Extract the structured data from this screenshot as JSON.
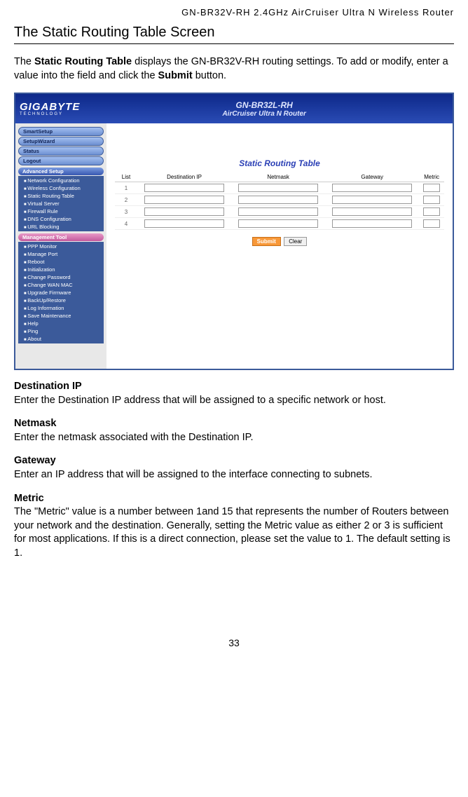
{
  "header": {
    "product": "GN-BR32V-RH 2.4GHz AirCruiser Ultra N Wireless Router"
  },
  "section": {
    "title": "The Static Routing Table Screen",
    "intro_pre": "The ",
    "intro_bold1": "Static Routing Table",
    "intro_mid": " displays the GN-BR32V-RH routing settings. To add or modify, enter a value into the field and click the ",
    "intro_bold2": "Submit",
    "intro_post": " button."
  },
  "screenshot": {
    "logo": {
      "brand": "GIGABYTE",
      "tagline": "TECHNOLOGY"
    },
    "model": {
      "line1": "GN-BR32L-RH",
      "line2": "AirCruiser Ultra N Router"
    },
    "sidebar": {
      "top_buttons": [
        "SmartSetup",
        "SetupWizard",
        "Status",
        "Logout"
      ],
      "advanced_header": "Advanced Setup",
      "advanced_items": [
        "Network Configuration",
        "Wireless Configuration",
        "Static Routing Table",
        "Virtual Server",
        "Firewall Rule",
        "DNS Configuration",
        "URL Blocking"
      ],
      "mgmt_header": "Management Tool",
      "mgmt_items": [
        "PPP Monitor",
        "Manage Port",
        "Reboot",
        "Initialization",
        "Change Password",
        "Change WAN MAC",
        "Upgrade Firmware",
        "BackUp/Restore",
        "Log Information",
        "Save Maintenance",
        "Help",
        "Ping",
        "About"
      ]
    },
    "table": {
      "title": "Static Routing Table",
      "headers": [
        "List",
        "Destination IP",
        "Netmask",
        "Gateway",
        "Metric"
      ],
      "rows": [
        "1",
        "2",
        "3",
        "4"
      ],
      "submit": "Submit",
      "clear": "Clear"
    }
  },
  "definitions": [
    {
      "term": "Destination IP",
      "desc": "Enter the Destination IP address that will be assigned to a specific network or host."
    },
    {
      "term": "Netmask",
      "desc": "Enter the netmask associated with the Destination IP."
    },
    {
      "term": "Gateway",
      "desc": "Enter an IP address that will be assigned to the interface connecting to subnets."
    },
    {
      "term": "Metric",
      "desc": "The \"Metric\" value is a number between 1and 15 that represents the number of Routers between your network and the destination. Generally, setting the Metric value as either 2 or 3 is sufficient for most applications. If this is a direct connection, please set the value to 1. The default setting is 1."
    }
  ],
  "page_number": "33"
}
